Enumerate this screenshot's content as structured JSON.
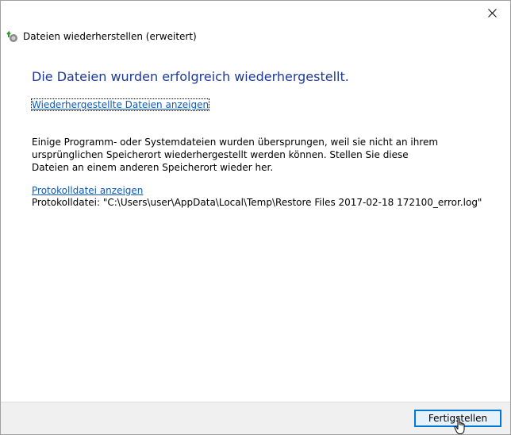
{
  "window": {
    "title": "Dateien wiederherstellen (erweitert)",
    "close_icon": "close-icon"
  },
  "main": {
    "heading": "Die Dateien wurden erfolgreich wiederhergestellt.",
    "show_restored_link": "Wiederhergestellte Dateien anzeigen",
    "info_text": "Einige Programm- oder Systemdateien wurden übersprungen, weil sie nicht an ihrem ursprünglichen Speicherort wiederhergestellt werden können. Stellen Sie diese Dateien an einem anderen Speicherort wieder her.",
    "show_log_link": "Protokolldatei anzeigen",
    "log_file_line": "Protokolldatei: \"C:\\Users\\user\\AppData\\Local\\Temp\\Restore Files 2017-02-18 172100_error.log\""
  },
  "footer": {
    "finish_label": "Fertigstellen"
  },
  "colors": {
    "heading": "#1e3a96",
    "link": "#0a5bbf",
    "button_border": "#0078d7",
    "button_bg": "#e5f1fb"
  }
}
